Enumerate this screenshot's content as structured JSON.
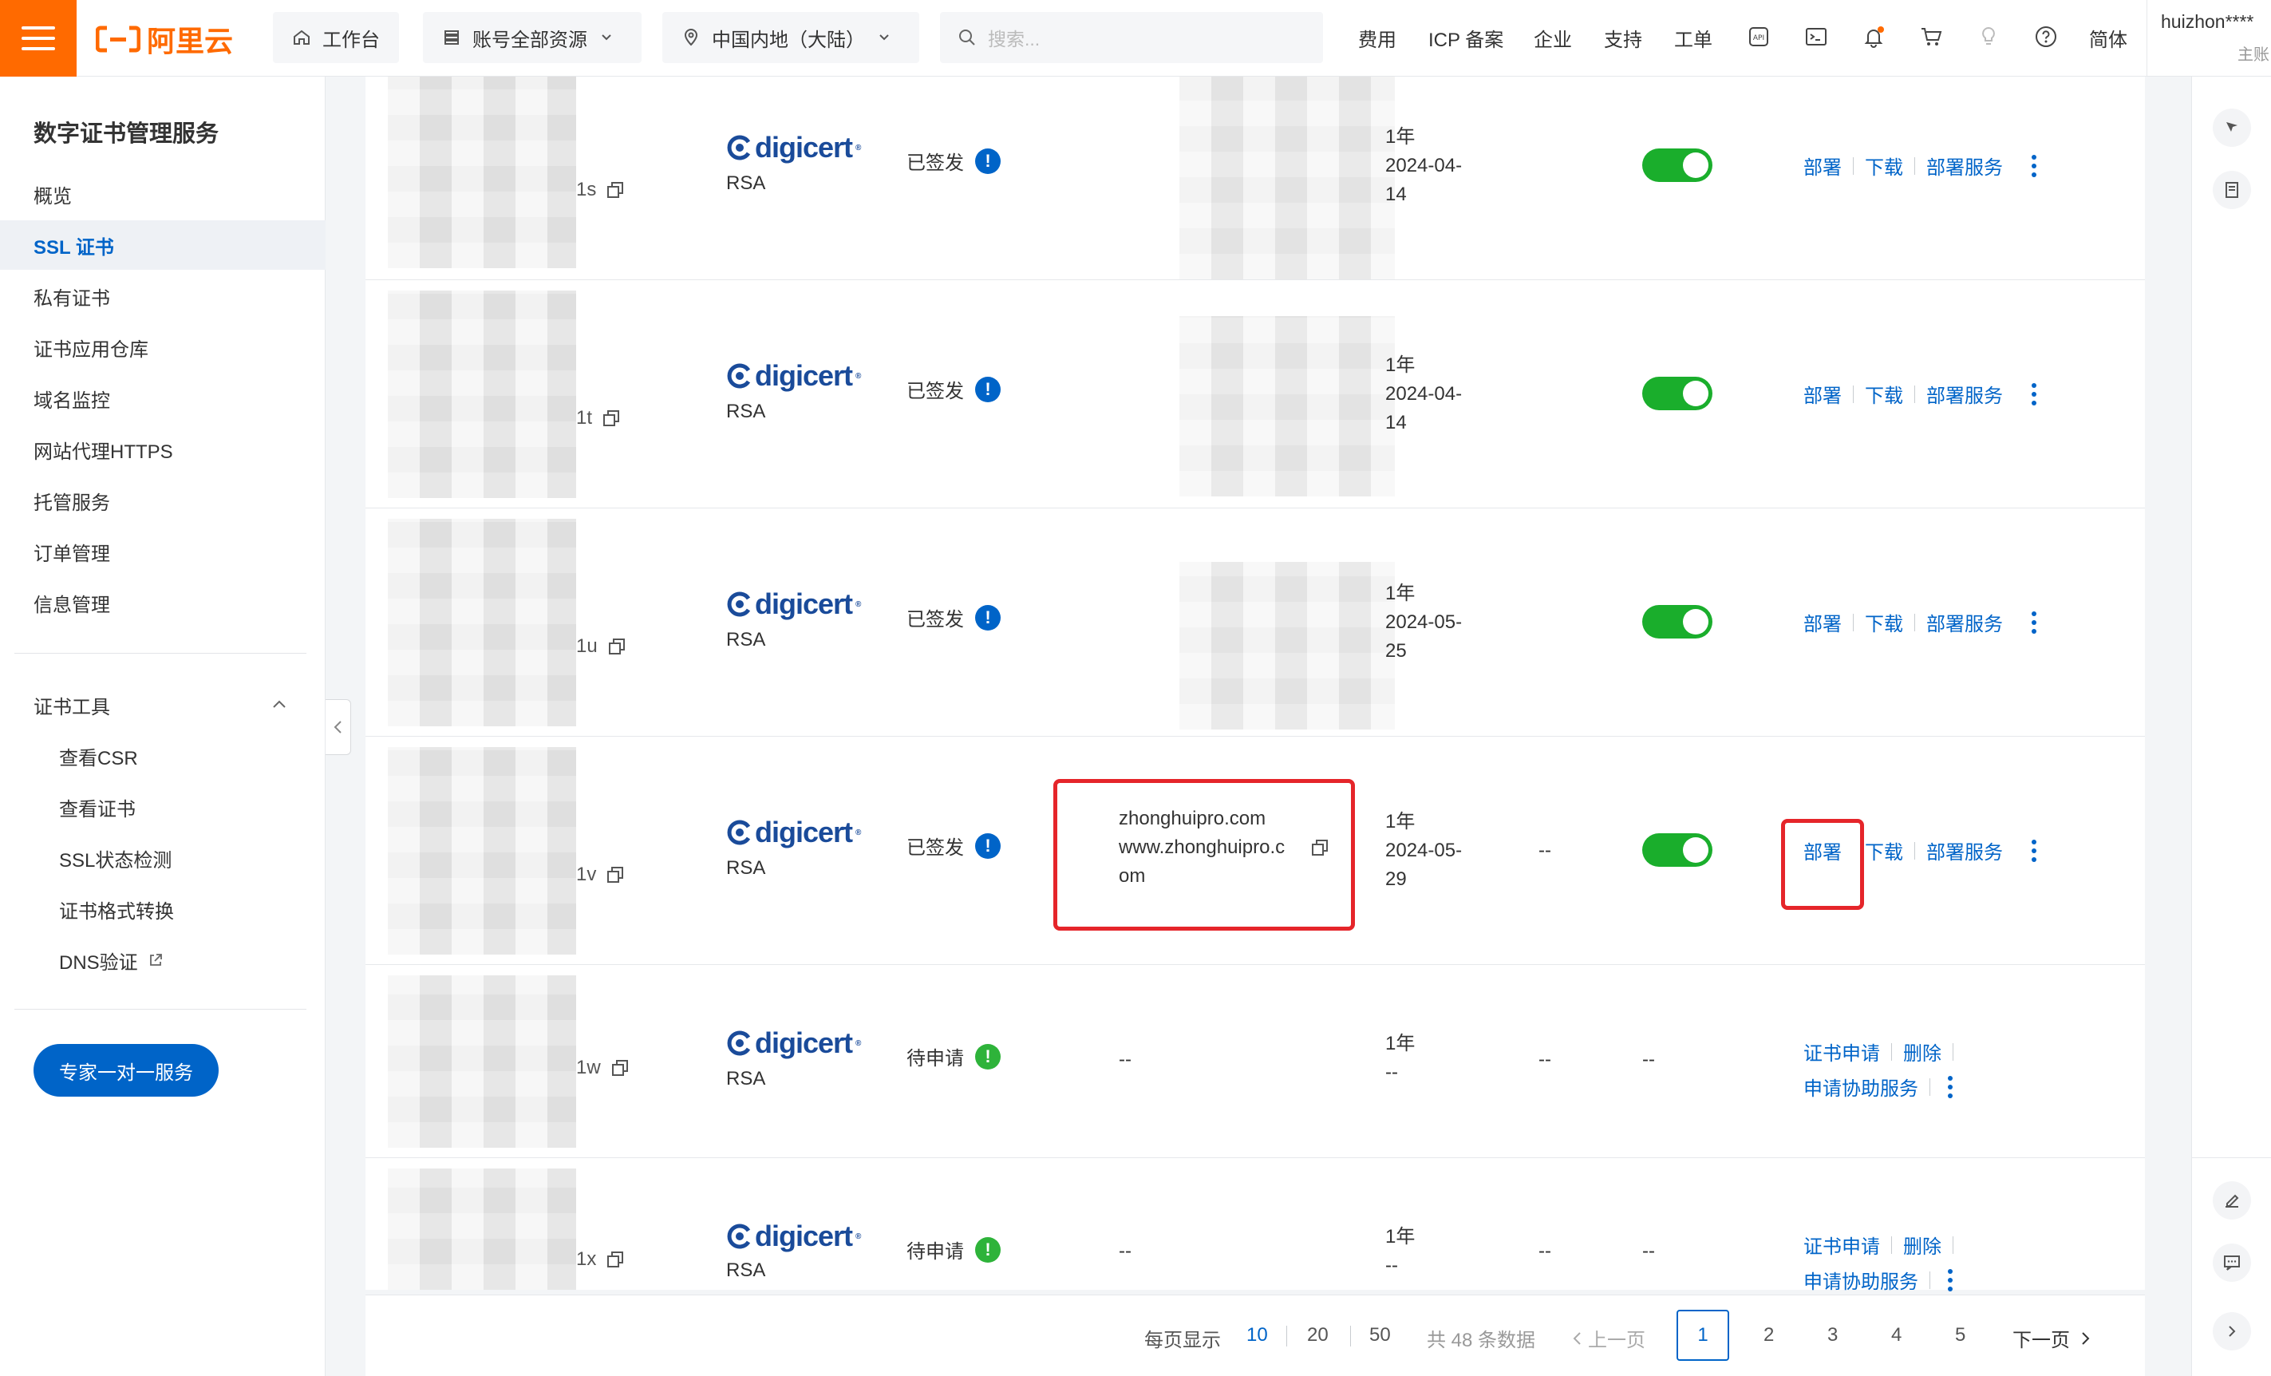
{
  "topbar": {
    "logo_text": "阿里云",
    "workbench": "工作台",
    "resource_scope": "账号全部资源",
    "region": "中国内地（大陆）",
    "search_placeholder": "搜索...",
    "nav": [
      "费用",
      "ICP 备案",
      "企业",
      "支持",
      "工单"
    ],
    "lang": "简体",
    "username": "huizhon****",
    "user_sub": "主账",
    "accent_color": "#ff6a00"
  },
  "sidebar": {
    "title": "数字证书管理服务",
    "items": [
      "概览",
      "SSL 证书",
      "私有证书",
      "证书应用仓库",
      "域名监控",
      "网站代理HTTPS",
      "托管服务",
      "订单管理",
      "信息管理"
    ],
    "active_item": "SSL 证书",
    "tools_group": "证书工具",
    "tools": [
      "查看CSR",
      "查看证书",
      "SSL状态检测",
      "证书格式转换",
      "DNS验证"
    ],
    "expert_button": "专家一对一服务"
  },
  "table": {
    "rows": [
      {
        "id_suffix": "1s",
        "brand": "digicert",
        "algo": "RSA",
        "status": "已签发",
        "status_type": "info",
        "domain_l1": "",
        "domain_l2": "",
        "domain_l3": "",
        "validity": "1年",
        "date_l1": "2024-04-",
        "date_l2": "14",
        "col_a": "",
        "col_b": "",
        "enabled": true,
        "actions": [
          "部署",
          "下载",
          "部署服务"
        ]
      },
      {
        "id_suffix": "1t",
        "brand": "digicert",
        "algo": "RSA",
        "status": "已签发",
        "status_type": "info",
        "domain_l1": "",
        "domain_l2": "",
        "domain_l3": "",
        "validity": "1年",
        "date_l1": "2024-04-",
        "date_l2": "14",
        "col_a": "",
        "col_b": "",
        "enabled": true,
        "actions": [
          "部署",
          "下载",
          "部署服务"
        ]
      },
      {
        "id_suffix": "1u",
        "brand": "digicert",
        "algo": "RSA",
        "status": "已签发",
        "status_type": "info",
        "domain_l1": "",
        "domain_l2": "",
        "domain_l3": "",
        "validity": "1年",
        "date_l1": "2024-05-",
        "date_l2": "25",
        "col_a": "",
        "col_b": "",
        "enabled": true,
        "actions": [
          "部署",
          "下载",
          "部署服务"
        ]
      },
      {
        "id_suffix": "1v",
        "brand": "digicert",
        "algo": "RSA",
        "status": "已签发",
        "status_type": "info",
        "domain_l1": "zhonghuipro.com",
        "domain_l2": "www.zhonghuipro.c",
        "domain_l3": "om",
        "validity": "1年",
        "date_l1": "2024-05-",
        "date_l2": "29",
        "col_a": "--",
        "col_b": "",
        "enabled": true,
        "actions": [
          "部署",
          "下载",
          "部署服务"
        ]
      },
      {
        "id_suffix": "1w",
        "brand": "digicert",
        "algo": "RSA",
        "status": "待申请",
        "status_type": "success",
        "domain_l1": "--",
        "domain_l2": "",
        "domain_l3": "",
        "validity": "1年",
        "date_l1": "--",
        "date_l2": "",
        "col_a": "--",
        "col_b": "--",
        "enabled": false,
        "actions": [
          "证书申请",
          "删除",
          "申请协助服务"
        ]
      },
      {
        "id_suffix": "1x",
        "brand": "digicert",
        "algo": "RSA",
        "status": "待申请",
        "status_type": "success",
        "domain_l1": "--",
        "domain_l2": "",
        "domain_l3": "",
        "validity": "1年",
        "date_l1": "--",
        "date_l2": "",
        "col_a": "--",
        "col_b": "--",
        "enabled": false,
        "actions": [
          "证书申请",
          "删除",
          "申请协助服务"
        ]
      }
    ]
  },
  "pagination": {
    "per_page_label": "每页显示",
    "sizes": [
      "10",
      "20",
      "50"
    ],
    "selected_size": "10",
    "total": "共 48 条数据",
    "prev": "上一页",
    "pages": [
      "1",
      "2",
      "3",
      "4",
      "5"
    ],
    "current_page": "1",
    "next": "下一页"
  }
}
